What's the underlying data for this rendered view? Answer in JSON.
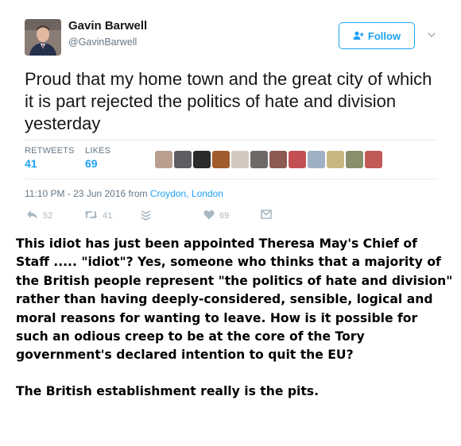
{
  "tweet": {
    "author_name": "Gavin Barwell",
    "author_handle": "@GavinBarwell",
    "follow_label": "Follow",
    "text": "Proud that my home town and the great city of which it is part rejected the politics of hate and division yesterday",
    "stats": {
      "retweets_label": "RETWEETS",
      "retweets_value": "41",
      "likes_label": "LIKES",
      "likes_value": "69"
    },
    "liker_avatar_colors": [
      "#b89f90",
      "#5d5e63",
      "#2b2b2b",
      "#a15b2c",
      "#d4c8c0",
      "#6f6a68",
      "#8c5a52",
      "#c45054",
      "#9fb0c4",
      "#c9b783",
      "#8a8f6b",
      "#c25a56"
    ],
    "timestamp": "11:10 PM - 23 Jun 2016 from",
    "location": "Croydon, London",
    "actions": {
      "reply_count": "52",
      "retweet_count": "41",
      "like_count": "69"
    }
  },
  "comment": {
    "paragraph1": "This idiot has just been appointed Theresa May's Chief of Staff ..... \"idiot\"? Yes, someone who thinks that a majority of the British people represent \"the politics of hate and division\" rather than having deeply-considered, sensible, logical and moral reasons for wanting to leave. How is it possible for such an odious creep to be at the core of the Tory government's declared intention to quit the EU?",
    "paragraph2": "The British establishment really is the pits."
  },
  "colors": {
    "accent": "#1da1f2",
    "muted": "#657786",
    "icon_gray": "#aab8c2",
    "divider": "#e6ecf0"
  },
  "icons": [
    "user-plus-icon",
    "chevron-down-icon",
    "reply-icon",
    "retweet-icon",
    "stack-icon",
    "heart-icon",
    "direct-message-icon"
  ]
}
